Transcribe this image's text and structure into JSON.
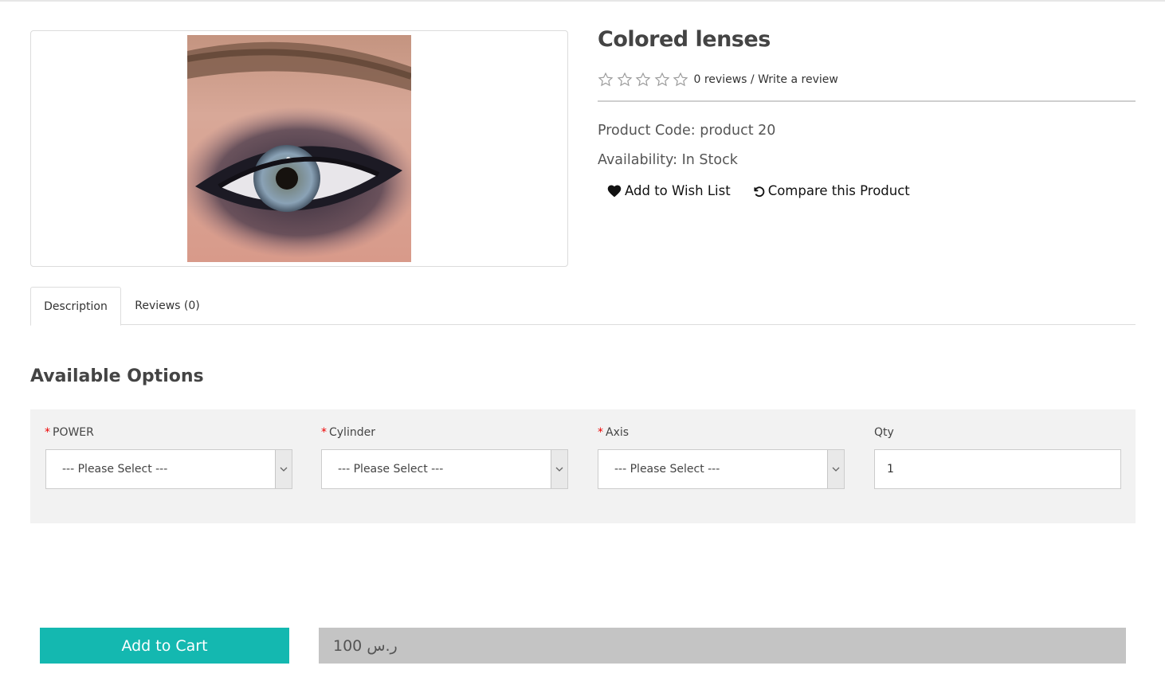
{
  "product": {
    "title": "Colored lenses",
    "image_alt": "eye with colored contact lens",
    "rating": {
      "stars_filled": 0,
      "stars_total": 5,
      "reviews_link": "0 reviews",
      "separator": "/",
      "write_link": "Write a review"
    },
    "code_label": "Product Code:",
    "code_value": "product 20",
    "availability_label": "Availability:",
    "availability_value": "In Stock",
    "wishlist_label": "Add to Wish List",
    "compare_label": "Compare this Product"
  },
  "tabs": [
    {
      "label": "Description",
      "active": true
    },
    {
      "label": "Reviews (0)",
      "active": false
    }
  ],
  "options": {
    "heading": "Available Options",
    "fields": [
      {
        "label": "POWER",
        "required": true,
        "value": "--- Please Select ---"
      },
      {
        "label": "Cylinder",
        "required": true,
        "value": "--- Please Select ---"
      },
      {
        "label": "Axis",
        "required": true,
        "value": "--- Please Select ---"
      }
    ],
    "qty": {
      "label": "Qty",
      "value": "1"
    },
    "required_mark": "*"
  },
  "cart": {
    "button_label": "Add to Cart",
    "price": "100 ر.س"
  },
  "colors": {
    "accent": "#14b8b0",
    "price_bar": "#c4c4c4",
    "options_bg": "#f2f2f2",
    "required": "#ee0000"
  },
  "icons": {
    "star": "star-outline-icon",
    "wishlist": "heart-icon",
    "compare": "refresh-icon",
    "select_arrow": "chevron-down-icon"
  }
}
